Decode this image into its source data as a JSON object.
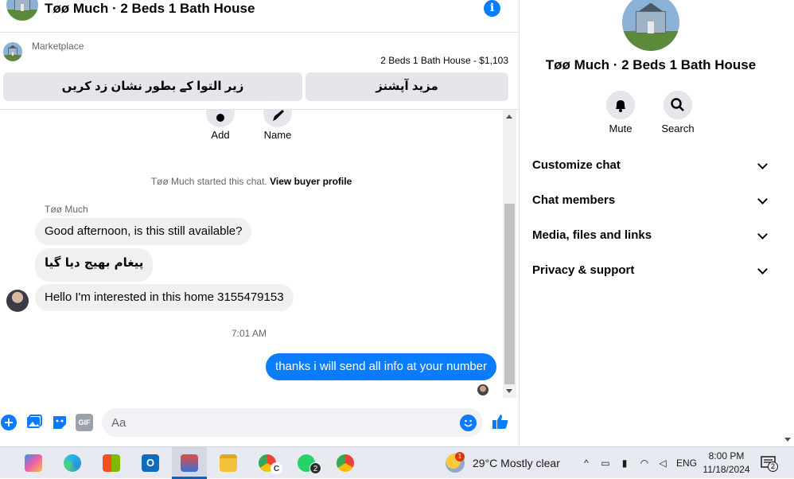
{
  "header": {
    "title": "Tøø Much · 2 Beds 1 Bath House",
    "info_icon": "info-icon"
  },
  "marketplace": {
    "label": "Marketplace",
    "listing": "2 Beds 1 Bath House - $1,103",
    "btn_mark": "زیر التوا کے بطور نشان زد کریں",
    "btn_more": "مزید آپشنز"
  },
  "conversation": {
    "add_label": "Add",
    "name_label": "Name",
    "system_prefix": "Tøø Much started this chat.",
    "system_link": "View buyer profile",
    "sender": "Tøø Much",
    "messages": [
      {
        "text": "Good afternoon, is this still available?",
        "direction": "in"
      },
      {
        "text": "پیغام بھیج دیا گیا",
        "direction": "in"
      },
      {
        "text": "Hello I'm interested in this home 3155479153",
        "direction": "in"
      }
    ],
    "timestamp": "7:01 AM",
    "reply": "thanks i will send all info at your number"
  },
  "composer": {
    "placeholder": "Aa",
    "gif_label": "GIF"
  },
  "side_panel": {
    "title": "Tøø Much · 2 Beds 1 Bath House",
    "mute_label": "Mute",
    "search_label": "Search",
    "sections": [
      "Customize chat",
      "Chat members",
      "Media, files and links",
      "Privacy & support"
    ]
  },
  "taskbar": {
    "weather_badge": "1",
    "weather": "29°C  Mostly clear",
    "whatsapp_badge": "2",
    "chrome_badge_letter": "C",
    "language": "ENG",
    "time": "8:00 PM",
    "date": "11/18/2024",
    "notification_count": "2"
  },
  "colors": {
    "accent": "#0a7cff",
    "bubble_in": "#f0f0f0",
    "secondary_text": "#65676b"
  }
}
